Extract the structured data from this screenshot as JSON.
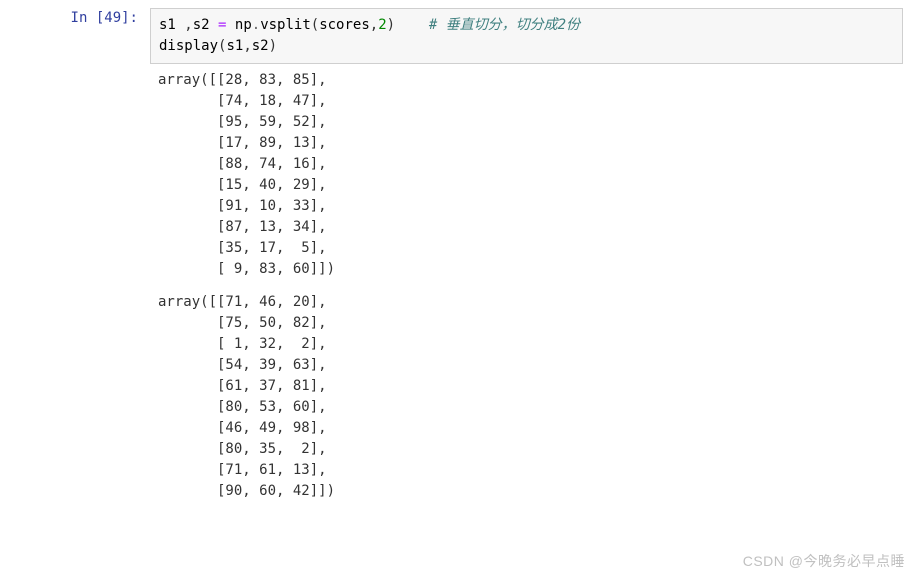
{
  "prompt": {
    "in_label": "In ",
    "exec_count": "[49]:"
  },
  "code": {
    "line1": {
      "var1": "s1 ",
      "comma1": ",",
      "var2": "s2 ",
      "assign": "= ",
      "module": "np",
      "dot": ".",
      "func": "vsplit",
      "lparen": "(",
      "arg1": "scores",
      "comma2": ",",
      "arg2": "2",
      "rparen": ")",
      "spacer": "    ",
      "comment": "# 垂直切分，切分成2份"
    },
    "line2": {
      "func": "display",
      "lparen": "(",
      "arg1": "s1",
      "comma": ",",
      "arg2": "s2",
      "rparen": ")"
    }
  },
  "output": {
    "array1": "array([[28, 83, 85],\n       [74, 18, 47],\n       [95, 59, 52],\n       [17, 89, 13],\n       [88, 74, 16],\n       [15, 40, 29],\n       [91, 10, 33],\n       [87, 13, 34],\n       [35, 17,  5],\n       [ 9, 83, 60]])",
    "array2": "array([[71, 46, 20],\n       [75, 50, 82],\n       [ 1, 32,  2],\n       [54, 39, 63],\n       [61, 37, 81],\n       [80, 53, 60],\n       [46, 49, 98],\n       [80, 35,  2],\n       [71, 61, 13],\n       [90, 60, 42]])"
  },
  "watermark": "CSDN @今晚务必早点睡"
}
